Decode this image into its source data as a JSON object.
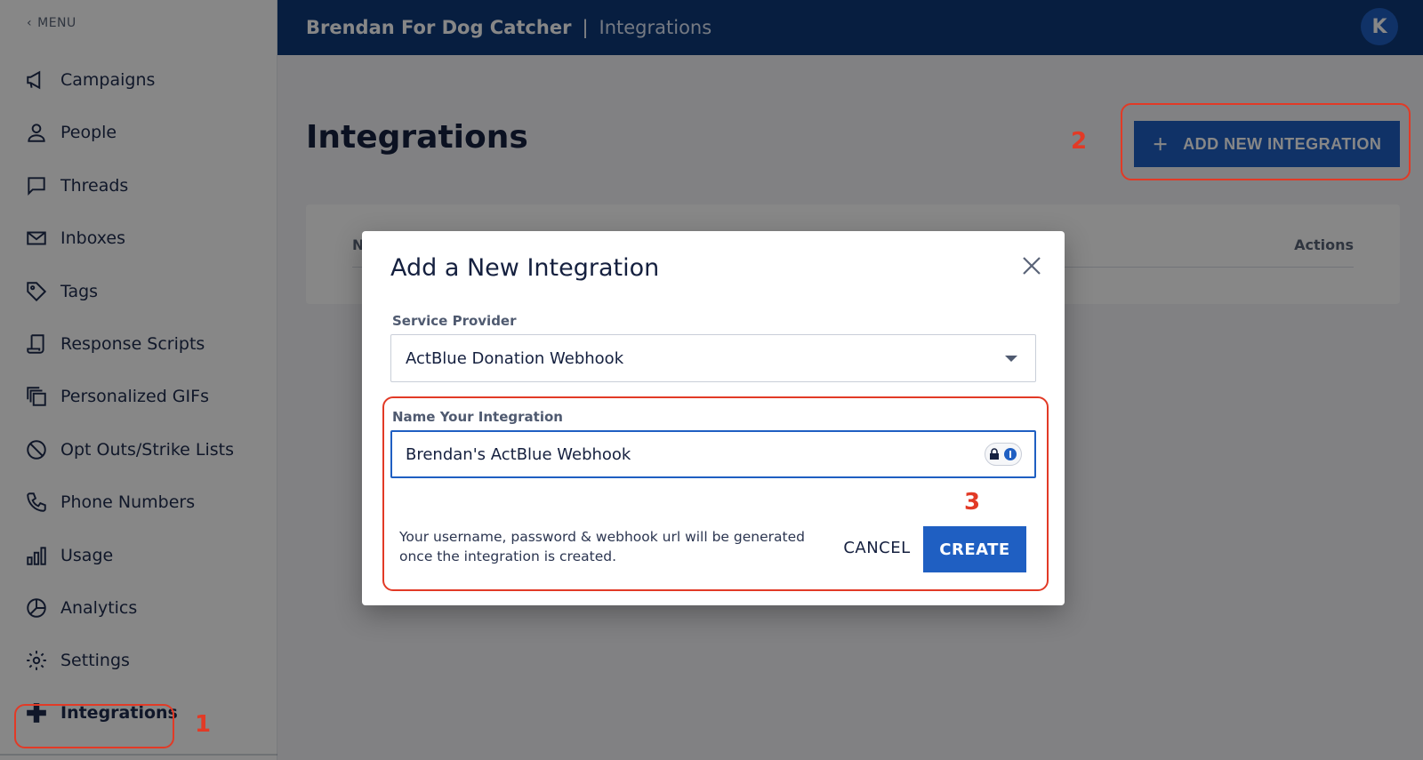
{
  "sidebar": {
    "menu_label": "MENU",
    "items": [
      {
        "label": "Campaigns",
        "icon": "megaphone-icon"
      },
      {
        "label": "People",
        "icon": "person-icon"
      },
      {
        "label": "Threads",
        "icon": "chat-bubble-icon"
      },
      {
        "label": "Inboxes",
        "icon": "mail-icon"
      },
      {
        "label": "Tags",
        "icon": "tag-icon"
      },
      {
        "label": "Response Scripts",
        "icon": "script-icon"
      },
      {
        "label": "Personalized GIFs",
        "icon": "copy-stack-icon"
      },
      {
        "label": "Opt Outs/Strike Lists",
        "icon": "block-icon"
      },
      {
        "label": "Phone Numbers",
        "icon": "phone-icon"
      },
      {
        "label": "Usage",
        "icon": "bar-chart-icon"
      },
      {
        "label": "Analytics",
        "icon": "pie-chart-icon"
      },
      {
        "label": "Settings",
        "icon": "gear-icon"
      },
      {
        "label": "Integrations",
        "icon": "plus-icon",
        "active": true
      }
    ]
  },
  "header": {
    "org_name": "Brendan For Dog Catcher",
    "separator": "|",
    "page_name": "Integrations",
    "avatar_initial": "K"
  },
  "main": {
    "title": "Integrations",
    "add_button_label": "ADD NEW INTEGRATION",
    "table_headers": [
      "N",
      "Actions"
    ]
  },
  "modal": {
    "title": "Add a New Integration",
    "service_provider_label": "Service Provider",
    "service_provider_value": "ActBlue Donation Webhook",
    "name_label": "Name Your Integration",
    "name_value": "Brendan's ActBlue Webhook",
    "helper_text": "Your username, password & webhook url will be generated once the integration is created.",
    "cancel_label": "CANCEL",
    "create_label": "CREATE"
  },
  "annotations": [
    "1",
    "2",
    "3"
  ],
  "colors": {
    "header_bg": "#0f3a7a",
    "primary": "#1f5fc2",
    "annotation": "#e23a26"
  }
}
